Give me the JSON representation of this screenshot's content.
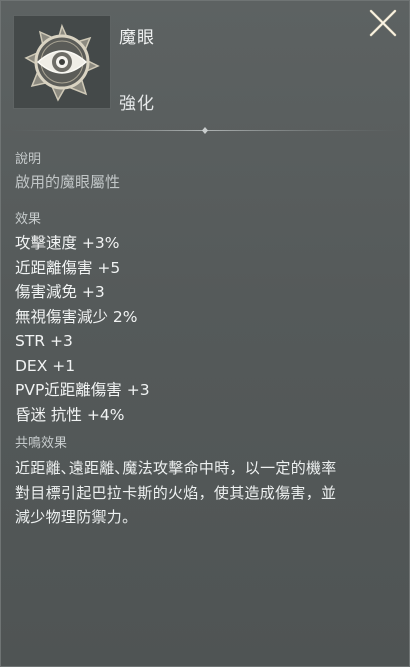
{
  "item": {
    "name": "魔眼",
    "type": "強化",
    "icon": "eye-emblem-icon"
  },
  "close_icon": "close-icon",
  "description": {
    "label": "說明",
    "text": "啟用的魔眼屬性"
  },
  "effects": {
    "label": "效果",
    "lines": [
      "攻擊速度 +3%",
      "近距離傷害 +5",
      "傷害減免 +3",
      "無視傷害減少 2%",
      "STR +3",
      "DEX +1",
      "PVP近距離傷害 +3",
      "昏迷 抗性 +4%"
    ]
  },
  "resonance": {
    "label": "共鳴效果",
    "lines": [
      "近距離､遠距離､魔法攻擊命中時，以一定的機率",
      "對目標引起巴拉卡斯的火焰，使其造成傷害，並",
      "減少物理防禦力。"
    ]
  },
  "colors": {
    "panel_bg": "#5a5f5f",
    "label_text": "#c7cccd",
    "body_text": "#f1f3f3",
    "close_icon": "#e9e0c8"
  }
}
